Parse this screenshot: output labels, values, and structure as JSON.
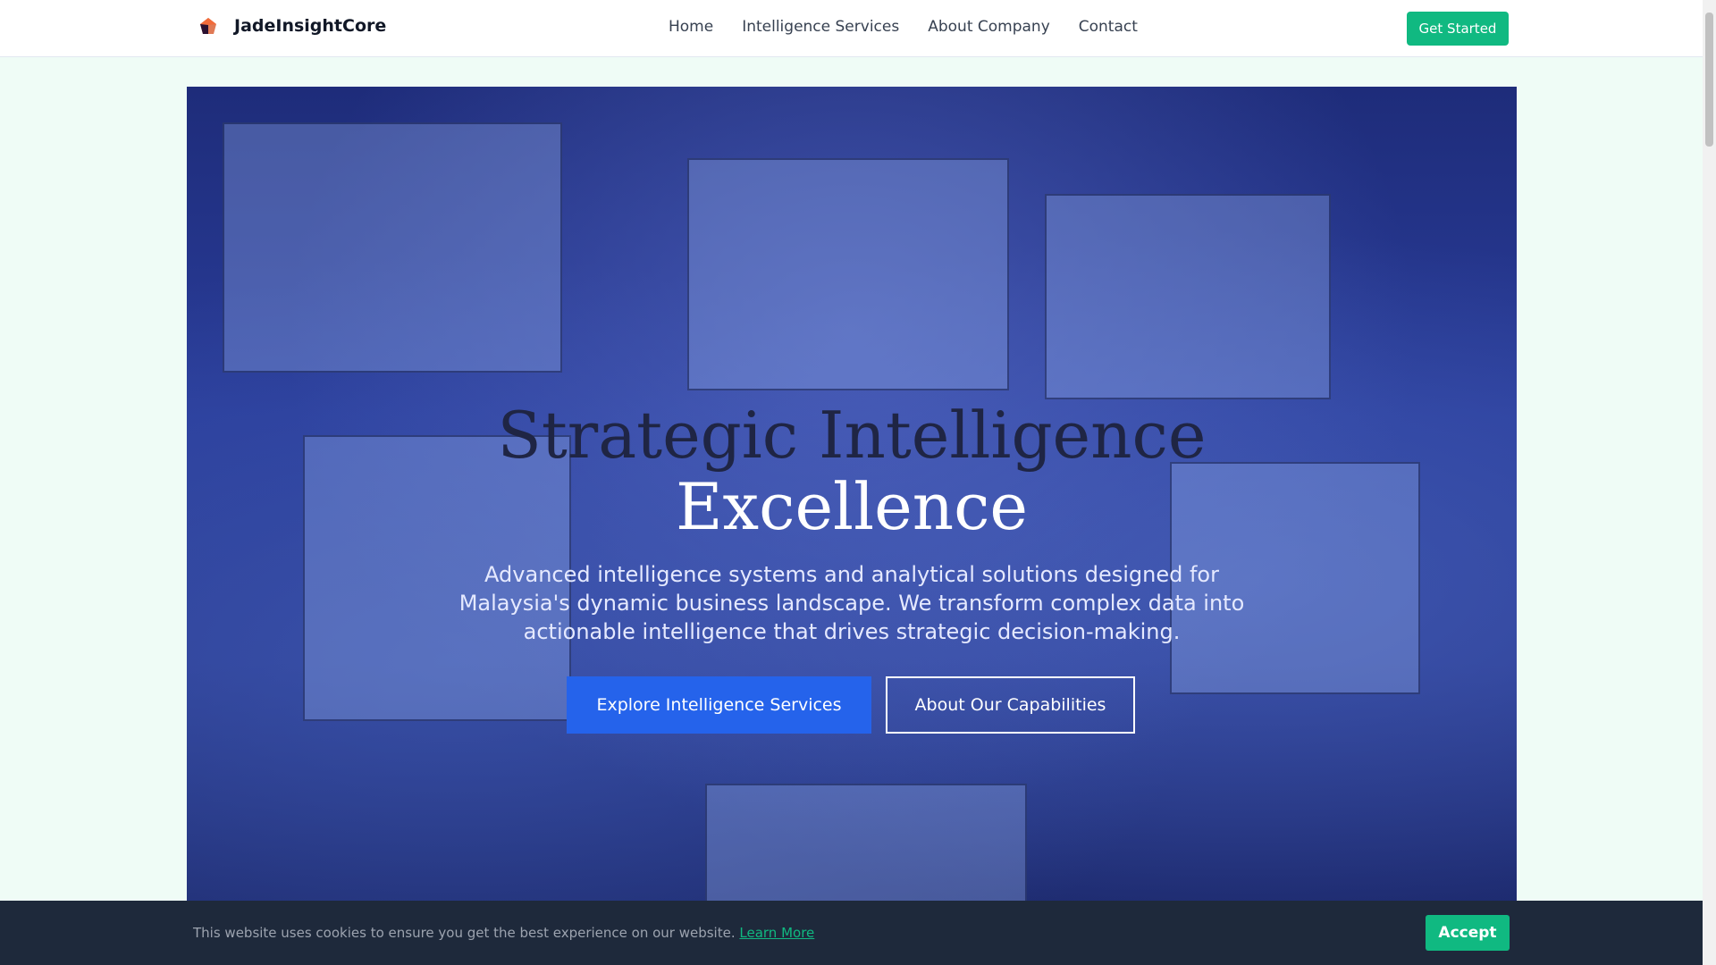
{
  "header": {
    "brand": "JadeInsightCore",
    "nav": [
      "Home",
      "Intelligence Services",
      "About Company",
      "Contact"
    ],
    "cta": "Get Started"
  },
  "hero": {
    "title_line1": "Strategic Intelligence",
    "title_line2": "Excellence",
    "description": "Advanced intelligence systems and analytical solutions designed for Malaysia's dynamic business landscape. We transform complex data into actionable intelligence that drives strategic decision-making.",
    "primary_button": "Explore Intelligence Services",
    "secondary_button": "About Our Capabilities"
  },
  "cookie": {
    "text": "This website uses cookies to ensure you get the best experience on our website.",
    "link": "Learn More",
    "accept": "Accept"
  },
  "colors": {
    "accent": "#10b981",
    "primary": "#2563eb",
    "cookie_bg": "#1e293b"
  }
}
